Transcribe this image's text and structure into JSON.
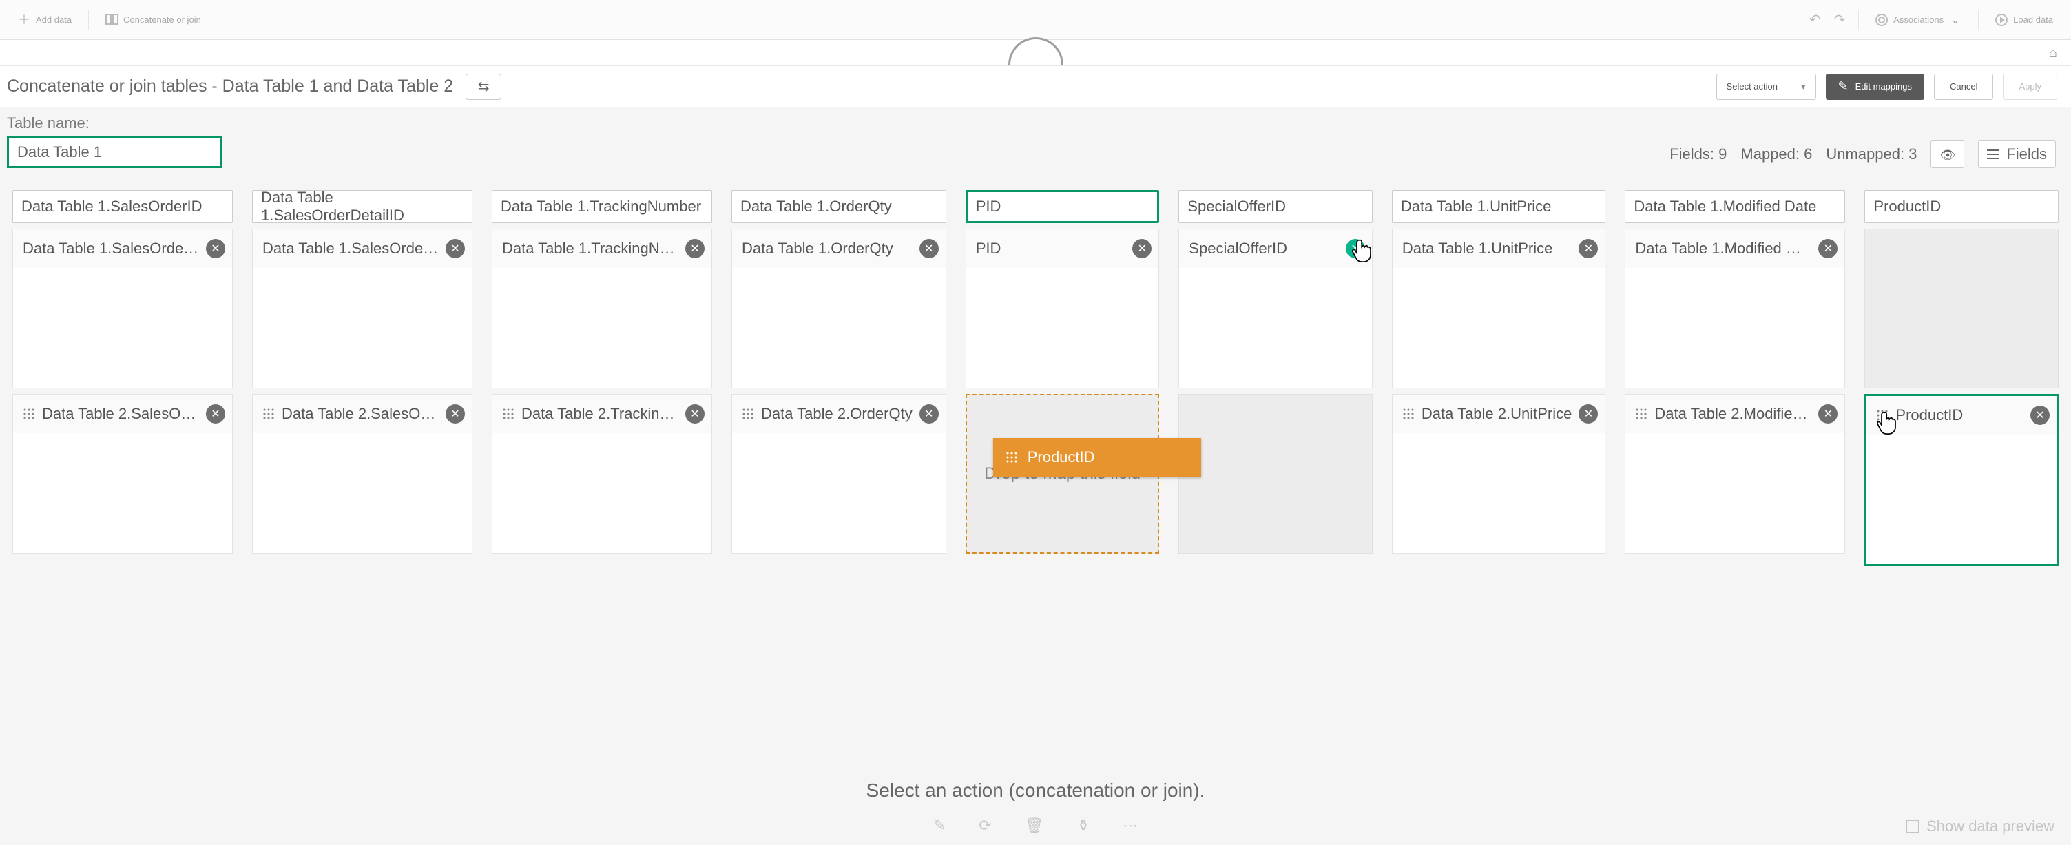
{
  "topbar": {
    "add_data": "Add data",
    "concat": "Concatenate or join",
    "associations": "Associations",
    "load_data": "Load data"
  },
  "action_row": {
    "title": "Concatenate or join tables - Data Table 1 and Data Table 2",
    "select_action": "Select action",
    "edit_mappings": "Edit mappings",
    "cancel": "Cancel",
    "apply": "Apply"
  },
  "meta": {
    "table_name_label": "Table name:",
    "table_name_value": "Data Table 1",
    "fields_label": "Fields: 9",
    "mapped_label": "Mapped: 6",
    "unmapped_label": "Unmapped: 3",
    "fields_btn": "Fields"
  },
  "columns": [
    {
      "header": "Data Table 1.SalesOrderID",
      "green": false,
      "row1": "Data Table 1.SalesOrderID",
      "row1_close": "grey",
      "row2": "Data Table 2.SalesOr…",
      "row2_close": "grey"
    },
    {
      "header": "Data Table 1.SalesOrderDetailID",
      "green": false,
      "row1": "Data Table 1.SalesOrder…",
      "row1_close": "grey",
      "row2": "Data Table 2.SalesOr…",
      "row2_close": "grey"
    },
    {
      "header": "Data Table 1.TrackingNumber",
      "green": false,
      "row1": "Data Table 1.TrackingNu…",
      "row1_close": "grey",
      "row2": "Data Table 2.Trackin…",
      "row2_close": "grey"
    },
    {
      "header": "Data Table 1.OrderQty",
      "green": false,
      "row1": "Data Table 1.OrderQty",
      "row1_close": "grey",
      "row2": "Data Table 2.OrderQty",
      "row2_close": "grey"
    },
    {
      "header": "PID",
      "green": true,
      "row1": "PID",
      "row1_close": "grey",
      "row2_is_drop": true,
      "row2": "",
      "drop_hint": "Drop to map this field",
      "drag_ghost": "ProductID"
    },
    {
      "header": "SpecialOfferID",
      "green": false,
      "row1": "SpecialOfferID",
      "row1_close": "green",
      "row2_grey": true,
      "row2": ""
    },
    {
      "header": "Data Table 1.UnitPrice",
      "green": false,
      "row1": "Data Table 1.UnitPrice",
      "row1_close": "grey",
      "row2": "Data Table 2.UnitPrice",
      "row2_close": "grey"
    },
    {
      "header": "Data Table 1.Modified Date",
      "green": false,
      "row1": "Data Table 1.Modified Date",
      "row1_close": "grey",
      "row2": "Data Table 2.Modifie…",
      "row2_close": "grey"
    },
    {
      "header": "ProductID",
      "green": false,
      "row1_grey": true,
      "row1": "",
      "row2": "ProductID",
      "row2_close": "grey",
      "row2_green_border": true,
      "row2_cursor": true
    }
  ],
  "bottom": {
    "hint": "Select an action (concatenation or join).",
    "show_preview": "Show data preview"
  }
}
